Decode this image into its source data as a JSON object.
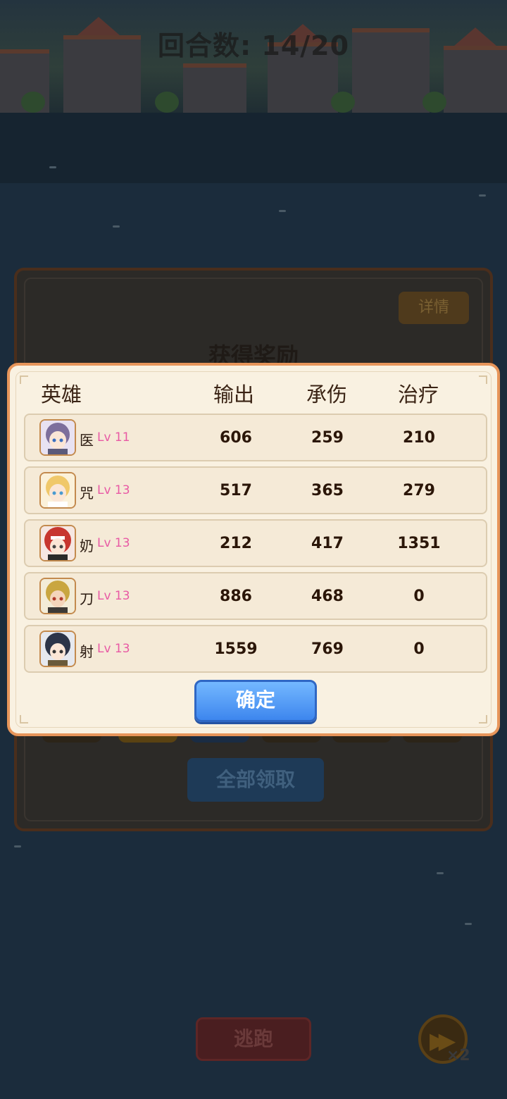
{
  "hud": {
    "round_counter": "回合数: 14/20"
  },
  "reward_panel": {
    "details_label": "详情",
    "title": "获得奖励",
    "claim_all_label": "全部领取"
  },
  "stats_dialog": {
    "headers": {
      "hero": "英雄",
      "damage": "输出",
      "tank": "承伤",
      "heal": "治疗"
    },
    "rows": [
      {
        "name": "医",
        "level": "Lv 11",
        "damage": "606",
        "tank": "259",
        "heal": "210",
        "avatar_hair": "#7d6f9c"
      },
      {
        "name": "咒",
        "level": "Lv 13",
        "damage": "517",
        "tank": "365",
        "heal": "279",
        "avatar_hair": "#f0c86a"
      },
      {
        "name": "奶",
        "level": "Lv 13",
        "damage": "212",
        "tank": "417",
        "heal": "1351",
        "avatar_hair": "#c7362f"
      },
      {
        "name": "刀",
        "level": "Lv 13",
        "damage": "886",
        "tank": "468",
        "heal": "0",
        "avatar_hair": "#c9a640"
      },
      {
        "name": "射",
        "level": "Lv 13",
        "damage": "1559",
        "tank": "769",
        "heal": "0",
        "avatar_hair": "#2c3448"
      }
    ],
    "confirm_label": "确定"
  },
  "controls": {
    "flee_label": "逃跑",
    "speed_label": "×2"
  },
  "colors": {
    "dialog_border": "#e7955a",
    "dialog_bg": "#f9f1e1",
    "level_text": "#e85aa4",
    "confirm_button": "#3d86ee"
  }
}
